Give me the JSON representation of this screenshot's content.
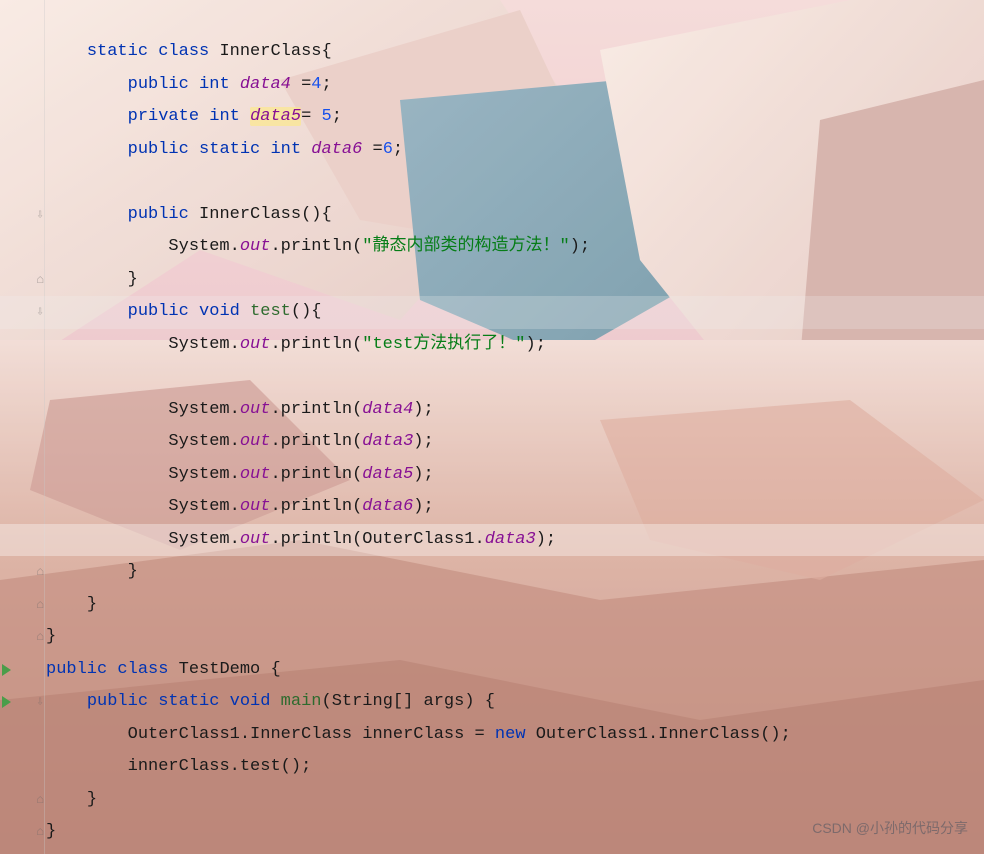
{
  "watermark": "CSDN @小孙的代码分享",
  "gutter": {
    "line1": "",
    "line2": "",
    "line3": "",
    "line4": "",
    "line5": "",
    "line6": "⇩",
    "line7": "",
    "line8": "⌂",
    "line9": "⇩",
    "line10": "",
    "line11": "",
    "line12": "",
    "line13": "",
    "line14": "",
    "line15": "",
    "line16": "",
    "line17": "⌂",
    "line18": "⌂",
    "line19": "⌂",
    "line20": "",
    "line21": "⇩",
    "line22": "",
    "line23": "",
    "line24": "⌂",
    "line25": "⌂"
  },
  "code": {
    "l1": {
      "ind": "    ",
      "kw1": "static",
      "sp1": " ",
      "kw2": "class",
      "sp2": " ",
      "cls": "InnerClass",
      "brace": "{"
    },
    "l2": {
      "ind": "        ",
      "kw1": "public",
      "sp1": " ",
      "type": "int",
      "sp2": " ",
      "field": "data4",
      "rest": " =",
      "num": "4",
      "semi": ";"
    },
    "l3": {
      "ind": "        ",
      "kw1": "private",
      "sp1": " ",
      "type": "int",
      "sp2": " ",
      "field": "data5",
      "rest": "= ",
      "num": "5",
      "semi": ";"
    },
    "l4": {
      "ind": "        ",
      "kw1": "public",
      "sp1": " ",
      "kw2": "static",
      "sp2": " ",
      "type": "int",
      "sp3": " ",
      "field": "data6",
      "rest": " =",
      "num": "6",
      "semi": ";"
    },
    "l6": {
      "ind": "        ",
      "kw1": "public",
      "sp1": " ",
      "ctor": "InnerClass",
      "paren": "(){"
    },
    "l7": {
      "ind": "            ",
      "sys": "System",
      "dot1": ".",
      "out": "out",
      "dot2": ".",
      "meth": "println",
      "open": "(",
      "str": "\"静态内部类的构造方法！\"",
      "close": ");"
    },
    "l8": {
      "ind": "        ",
      "brace": "}"
    },
    "l9": {
      "ind": "        ",
      "kw1": "public",
      "sp1": " ",
      "kw2": "void",
      "sp2": " ",
      "meth": "test",
      "paren": "(){"
    },
    "l10": {
      "ind": "            ",
      "sys": "System",
      "dot1": ".",
      "out": "out",
      "dot2": ".",
      "meth": "println",
      "open": "(",
      "str": "\"test方法执行了！\"",
      "close": ");"
    },
    "l12": {
      "ind": "            ",
      "sys": "System",
      "dot1": ".",
      "out": "out",
      "dot2": ".",
      "meth": "println",
      "open": "(",
      "arg": "data4",
      "close": ");"
    },
    "l13": {
      "ind": "            ",
      "sys": "System",
      "dot1": ".",
      "out": "out",
      "dot2": ".",
      "meth": "println",
      "open": "(",
      "arg": "data3",
      "close": ");"
    },
    "l14": {
      "ind": "            ",
      "sys": "System",
      "dot1": ".",
      "out": "out",
      "dot2": ".",
      "meth": "println",
      "open": "(",
      "arg": "data5",
      "close": ");"
    },
    "l15": {
      "ind": "            ",
      "sys": "System",
      "dot1": ".",
      "out": "out",
      "dot2": ".",
      "meth": "println",
      "open": "(",
      "arg": "data6",
      "close": ");"
    },
    "l16": {
      "ind": "            ",
      "sys": "System",
      "dot1": ".",
      "out": "out",
      "dot2": ".",
      "meth": "println",
      "open": "(",
      "cls": "OuterClass1",
      "dot3": ".",
      "arg": "data3",
      "close": ");"
    },
    "l17": {
      "ind": "        ",
      "brace": "}"
    },
    "l18": {
      "ind": "    ",
      "brace": "}"
    },
    "l19": {
      "ind": "",
      "brace": "}"
    },
    "l20": {
      "ind": "",
      "kw1": "public",
      "sp1": " ",
      "kw2": "class",
      "sp2": " ",
      "cls": "TestDemo",
      "sp3": " ",
      "brace": "{"
    },
    "l21": {
      "ind": "    ",
      "kw1": "public",
      "sp1": " ",
      "kw2": "static",
      "sp2": " ",
      "kw3": "void",
      "sp3": " ",
      "meth": "main",
      "open": "(",
      "type": "String",
      "arr": "[] ",
      "param": "args",
      "close": ") {"
    },
    "l22": {
      "ind": "        ",
      "cls1": "OuterClass1",
      "dot1": ".",
      "cls2": "InnerClass",
      "sp1": " ",
      "var": "innerClass",
      "sp2": " = ",
      "kw": "new",
      "sp3": " ",
      "cls3": "OuterClass1",
      "dot2": ".",
      "cls4": "InnerClass",
      "paren": "();"
    },
    "l23": {
      "ind": "        ",
      "var": "innerClass",
      "dot": ".",
      "meth": "test",
      "paren": "();"
    },
    "l24": {
      "ind": "    ",
      "brace": "}"
    },
    "l25": {
      "ind": "",
      "brace": "}"
    }
  }
}
